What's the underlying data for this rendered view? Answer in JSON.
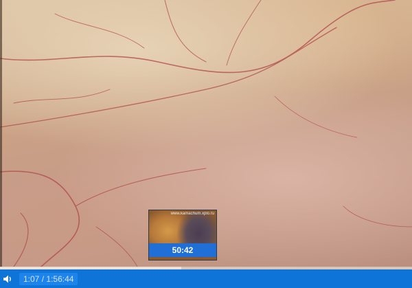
{
  "player": {
    "current_time": "1:07",
    "separator": "/",
    "duration": "1:56:44",
    "buffered_fraction": 0.44
  },
  "preview": {
    "time": "50:42",
    "watermark": "www.kamachum.xplo.ru"
  },
  "colors": {
    "control_bar": "#0f74d8",
    "preview_bar": "#1f6fd6"
  },
  "icons": {
    "volume": "volume-icon"
  }
}
